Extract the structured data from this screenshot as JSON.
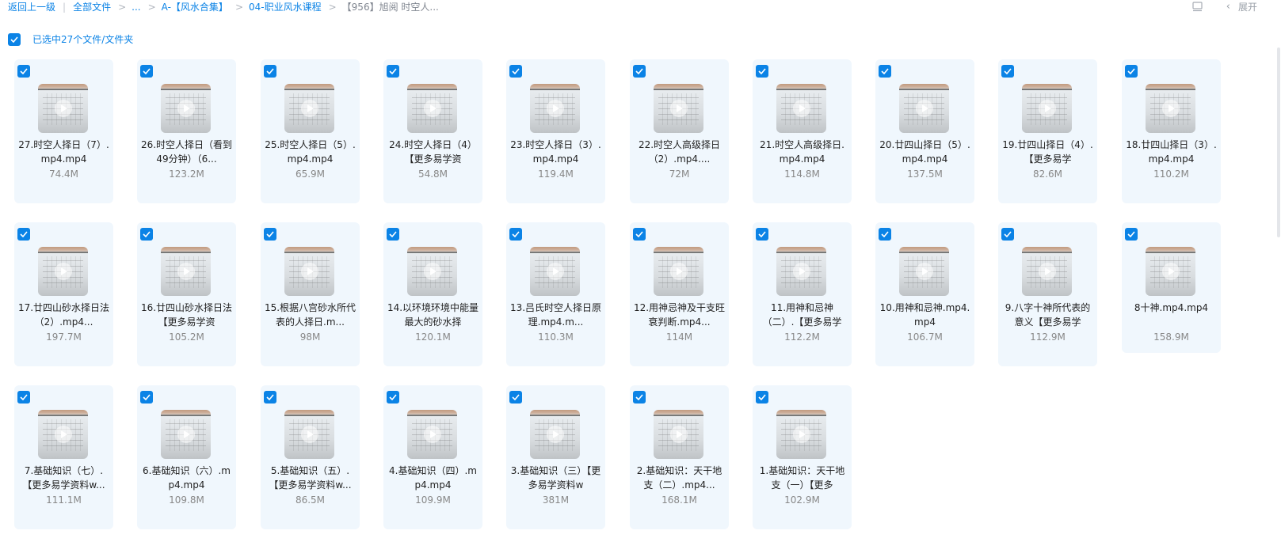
{
  "breadcrumb": {
    "back": "返回上一级",
    "all_files": "全部文件",
    "ellipsis": "...",
    "folder1": "A-【风水合集】",
    "folder2": "04-职业风水课程",
    "current": "【956】旭阅 时空人..."
  },
  "toolbar": {
    "expand_label": "展开",
    "layout_icon": "layout-icon",
    "chevron_icon": "chevron-left-icon"
  },
  "selection": {
    "label": "已选中27个文件/文件夹"
  },
  "colors": {
    "accent": "#0b83e6",
    "card_bg": "#f0f7fd"
  },
  "files": [
    {
      "name": "27.时空人择日（7）.mp4.mp4",
      "size": "74.4M"
    },
    {
      "name": "26.时空人择日（看到49分钟）（6...",
      "size": "123.2M"
    },
    {
      "name": "25.时空人择日（5）.mp4.mp4",
      "size": "65.9M"
    },
    {
      "name": "24.时空人择日（4）【更多易学资",
      "size": "54.8M"
    },
    {
      "name": "23.时空人择日（3）.mp4.mp4",
      "size": "119.4M"
    },
    {
      "name": "22.时空人高级择日（2）.mp4....",
      "size": "72M"
    },
    {
      "name": "21.时空人高级择日.mp4.mp4",
      "size": "114.8M"
    },
    {
      "name": "20.廿四山择日（5）.mp4.mp4",
      "size": "137.5M"
    },
    {
      "name": "19.廿四山择日（4）.【更多易学",
      "size": "82.6M"
    },
    {
      "name": "18.廿四山择日（3）.mp4.mp4",
      "size": "110.2M"
    },
    {
      "name": "17.廿四山砂水择日法（2）.mp4...",
      "size": "197.7M"
    },
    {
      "name": "16.廿四山砂水择日法【更多易学资",
      "size": "105.2M"
    },
    {
      "name": "15.根据八宫砂水所代表的人择日.m...",
      "size": "98M"
    },
    {
      "name": "14.以环境环境中能量最大的砂水择",
      "size": "120.1M"
    },
    {
      "name": "13.吕氏时空人择日原理.mp4.m...",
      "size": "110.3M"
    },
    {
      "name": "12.用神忌神及干支旺衰判断.mp4...",
      "size": "114M"
    },
    {
      "name": "11.用神和忌神（二）.【更多易学",
      "size": "112.2M"
    },
    {
      "name": "10.用神和忌神.mp4.mp4",
      "size": "106.7M"
    },
    {
      "name": "9.八字十神所代表的意义【更多易学",
      "size": "112.9M"
    },
    {
      "name": "8十神.mp4.mp4",
      "size": "158.9M"
    },
    {
      "name": "7.基础知识（七）.【更多易学资料w...",
      "size": "111.1M"
    },
    {
      "name": "6.基础知识（六）.mp4.mp4",
      "size": "109.8M"
    },
    {
      "name": "5.基础知识（五）.【更多易学资料w...",
      "size": "86.5M"
    },
    {
      "name": "4.基础知识（四）.mp4.mp4",
      "size": "109.9M"
    },
    {
      "name": "3.基础知识（三）【更多易学资料w",
      "size": "381M"
    },
    {
      "name": "2.基础知识：天干地支（二）.mp4...",
      "size": "168.1M"
    },
    {
      "name": "1.基础知识：天干地支（一）【更多",
      "size": "102.9M"
    }
  ]
}
